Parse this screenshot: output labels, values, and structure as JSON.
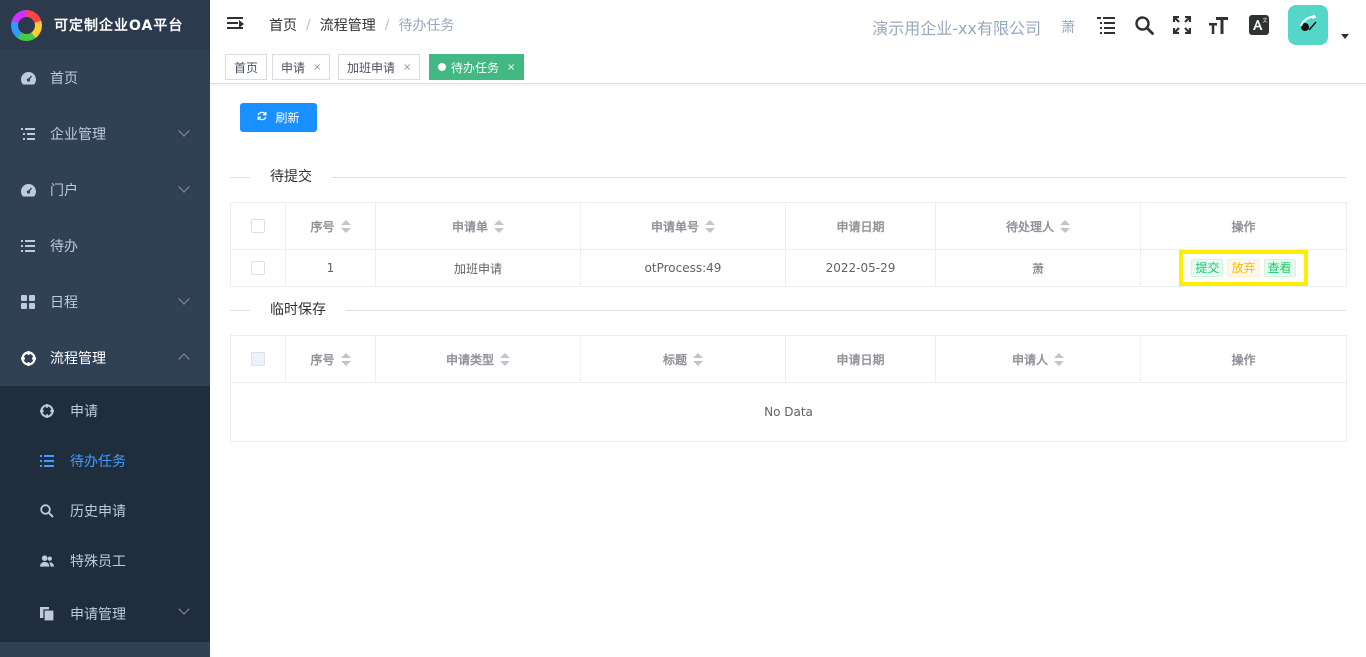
{
  "app": {
    "title": "可定制企业OA平台"
  },
  "sidebar": {
    "items": [
      {
        "label": "首页",
        "icon": "dashboard-icon"
      },
      {
        "label": "企业管理",
        "icon": "list-icon"
      },
      {
        "label": "门户",
        "icon": "dashboard-icon"
      },
      {
        "label": "待办",
        "icon": "list-icon"
      },
      {
        "label": "日程",
        "icon": "grid-icon"
      },
      {
        "label": "流程管理",
        "icon": "process-icon"
      }
    ],
    "subitems": [
      {
        "label": "申请",
        "icon": "process-icon"
      },
      {
        "label": "待办任务",
        "icon": "list-icon"
      },
      {
        "label": "历史申请",
        "icon": "search-icon"
      },
      {
        "label": "特殊员工",
        "icon": "people-icon"
      },
      {
        "label": "申请管理",
        "icon": "documents-icon"
      }
    ]
  },
  "header": {
    "breadcrumb": [
      "首页",
      "流程管理",
      "待办任务"
    ],
    "company": "演示用企业-xx有限公司",
    "user": "萧"
  },
  "tags": [
    {
      "label": "首页"
    },
    {
      "label": "申请",
      "close": "×"
    },
    {
      "label": "加班申请",
      "close": "×"
    },
    {
      "label": "待办任务",
      "close": "×"
    }
  ],
  "toolbar": {
    "refresh_label": "刷新"
  },
  "pending": {
    "title": "待提交",
    "columns": [
      "序号",
      "申请单",
      "申请单号",
      "申请日期",
      "待处理人",
      "操作"
    ],
    "rows": [
      {
        "index": "1",
        "form": "加班申请",
        "form_no": "otProcess:49",
        "date": "2022-05-29",
        "handler": "萧"
      }
    ],
    "actions": {
      "submit": "提交",
      "abandon": "放弃",
      "view": "查看"
    }
  },
  "drafts": {
    "title": "临时保存",
    "columns": [
      "序号",
      "申请类型",
      "标题",
      "申请日期",
      "申请人",
      "操作"
    ],
    "empty_text": "No Data"
  },
  "colors": {
    "sidebar_bg": "#304156",
    "submenu_bg": "#1f2d3d",
    "active_tag": "#42b983",
    "primary": "#1890ff",
    "highlight": "#ffee00"
  }
}
